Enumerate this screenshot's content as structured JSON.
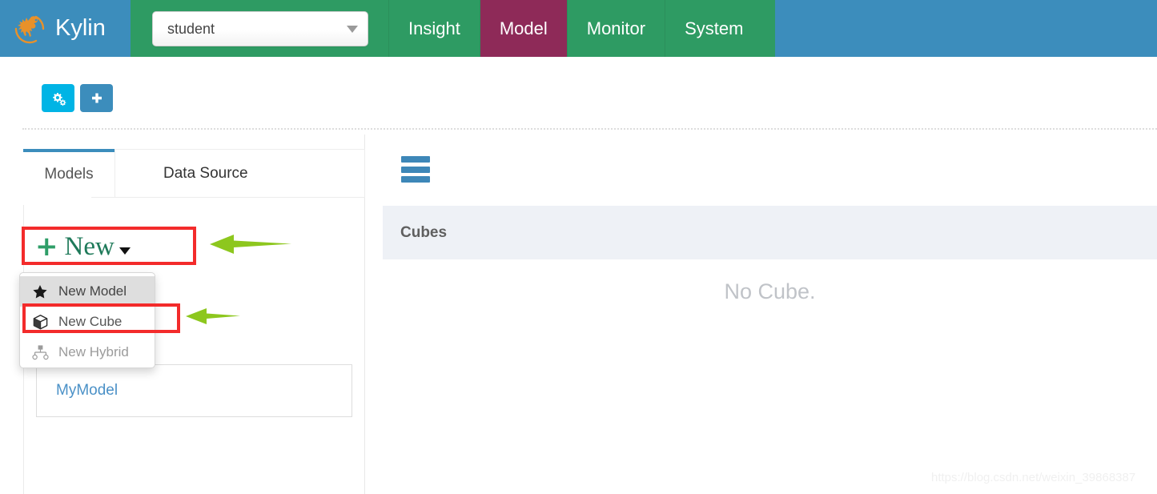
{
  "header": {
    "brand_name": "Kylin",
    "brand_logo_icon": "kylin-creature-logo",
    "project_select": {
      "value": "student",
      "caret_icon": "caret-down-icon"
    },
    "nav_tabs": [
      {
        "label": "Insight",
        "active": false
      },
      {
        "label": "Model",
        "active": true
      },
      {
        "label": "Monitor",
        "active": false
      },
      {
        "label": "System",
        "active": false
      }
    ]
  },
  "toolbar": {
    "buttons": [
      {
        "name": "gears-button",
        "icon": "gears-icon",
        "color": "#00b4e5"
      },
      {
        "name": "add-button",
        "icon": "plus-icon",
        "color": "#3c8dbc"
      }
    ]
  },
  "sidebar": {
    "tabs": [
      {
        "label": "Models",
        "active": true
      },
      {
        "label": "Data Source",
        "active": false
      }
    ],
    "new_button": {
      "plus_glyph": "+",
      "label": "New",
      "caret_icon": "caret-down-icon"
    },
    "dropdown": {
      "items": [
        {
          "label": "New Model",
          "icon": "star-icon",
          "state": "hover"
        },
        {
          "label": "New Cube",
          "icon": "cube-icon",
          "state": "highlighted"
        },
        {
          "label": "New Hybrid",
          "icon": "sitemap-icon",
          "state": "muted"
        }
      ]
    },
    "models": [
      {
        "name": "MyModel"
      }
    ]
  },
  "main": {
    "menu_icon": "hamburger-icon",
    "section_title": "Cubes",
    "empty_message": "No Cube."
  },
  "annotations": {
    "box_color": "#f32b2b",
    "arrow_color": "#8dc71e",
    "boxes": [
      {
        "target": "new-button"
      },
      {
        "target": "new-cube-menu-item"
      }
    ],
    "arrows": [
      {
        "direction": "left",
        "target": "new-button"
      },
      {
        "direction": "left",
        "target": "new-cube-menu-item"
      }
    ]
  },
  "watermark": {
    "text": "https://blog.csdn.net/weixin_39868387"
  }
}
